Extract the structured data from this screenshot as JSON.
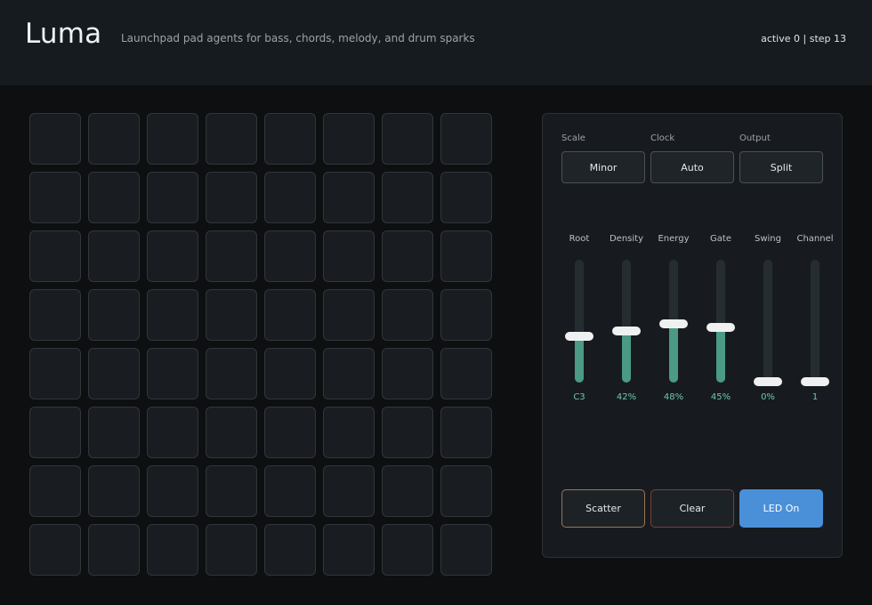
{
  "header": {
    "title": "Luma",
    "subtitle": "Launchpad pad agents for bass, chords, melody, and drum sparks",
    "status": "active 0 | step 13"
  },
  "colors": {
    "background": "#0d0f11",
    "header": "#161b20",
    "pad": "#191d21",
    "slider_fill": "#4a9a86",
    "slider_value_text": "#6fc6ad",
    "led_button": "#4a90d9",
    "scatter_border": "#9a7450",
    "clear_border": "#7a3e3e"
  },
  "grid": {
    "rows": 8,
    "cols": 8,
    "active_pads": 0
  },
  "panel": {
    "selectors": [
      {
        "label": "Scale",
        "value": "Minor"
      },
      {
        "label": "Clock",
        "value": "Auto"
      },
      {
        "label": "Output",
        "value": "Split"
      }
    ],
    "sliders": [
      {
        "label": "Root",
        "value": "C3",
        "level": 0.38
      },
      {
        "label": "Density",
        "value": "42%",
        "level": 0.42
      },
      {
        "label": "Energy",
        "value": "48%",
        "level": 0.48
      },
      {
        "label": "Gate",
        "value": "45%",
        "level": 0.45
      },
      {
        "label": "Swing",
        "value": "0%",
        "level": 0
      },
      {
        "label": "Channel",
        "value": "1",
        "level": 0
      }
    ],
    "actions": {
      "scatter": "Scatter",
      "clear": "Clear",
      "led": "LED On"
    }
  }
}
